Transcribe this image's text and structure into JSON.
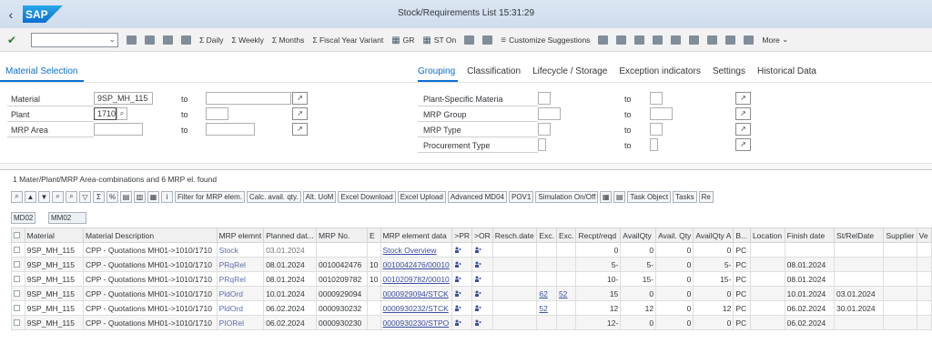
{
  "shell": {
    "title": "Stock/Requirements List 15:31:29",
    "logo": "SAP"
  },
  "toolbar": {
    "buttons": [
      "Σ Daily",
      "Σ Weekly",
      "Σ Months",
      "Σ Fiscal Year Variant",
      "GR",
      "ST On",
      "Customize Suggestions",
      "More"
    ]
  },
  "selection": {
    "section_title": "Material Selection",
    "tabs": [
      "Grouping",
      "Classification",
      "Lifecycle / Storage",
      "Exception indicators",
      "Settings",
      "Historical Data"
    ],
    "fields": {
      "material_label": "Material",
      "material_value": "9SP_MH_115",
      "plant_label": "Plant",
      "plant_value": "1710",
      "mrp_area_label": "MRP Area",
      "to": "to",
      "plant_specific_label": "Plant-Specific Materia",
      "mrp_group_label": "MRP Group",
      "mrp_type_label": "MRP Type",
      "procurement_label": "Procurement Type"
    }
  },
  "results": {
    "summary": "1 Mater/Plant/MRP Area-combinations and 6 MRP el. found",
    "alv_buttons": [
      "Filter for MRP elem.",
      "Calc. avail. qty.",
      "Alt. UoM",
      "Excel Download",
      "Excel Upload",
      "Advanced MD04",
      "POV1",
      "Simulation On/Off",
      "Task Object",
      "Tasks",
      "Re"
    ],
    "variants": [
      "MD02",
      "MM02"
    ],
    "columns": [
      "",
      "Material",
      "Material Description",
      "MRP elemnt",
      "Planned dat...",
      "MRP No.",
      "E",
      "MRP element data",
      ">PR",
      ">OR",
      "Resch.date",
      "Exc.",
      "Exc.",
      "Recpt/reqd",
      "AvailQty",
      "Avail. Qty",
      "AvailQty A",
      "B...",
      "Location",
      "Finish date",
      "St/RelDate",
      "Supplier",
      "Ve"
    ],
    "rows": [
      {
        "material": "9SP_MH_115",
        "desc": "CPP - Quotations MH01->1010/1710",
        "elem": "Stock",
        "planned": "03.01.2024",
        "mrpno": "",
        "e": "",
        "data": "Stock Overview",
        "exc1": "",
        "exc2": "",
        "recpt": "0",
        "avail": "0",
        "availq": "0",
        "availa": "0",
        "b": "PC",
        "loc": "",
        "finish": "",
        "strel": ""
      },
      {
        "material": "9SP_MH_115",
        "desc": "CPP - Quotations MH01->1010/1710",
        "elem": "PRqRel",
        "planned": "08.01.2024",
        "mrpno": "0010042476",
        "e": "10",
        "data": "0010042476/00010",
        "exc1": "",
        "exc2": "",
        "recpt": "5-",
        "avail": "5-",
        "availq": "0",
        "availa": "5-",
        "b": "PC",
        "loc": "",
        "finish": "08.01.2024",
        "strel": ""
      },
      {
        "material": "9SP_MH_115",
        "desc": "CPP - Quotations MH01->1010/1710",
        "elem": "PRqRel",
        "planned": "08.01.2024",
        "mrpno": "0010209782",
        "e": "10",
        "data": "0010209782/00010",
        "exc1": "",
        "exc2": "",
        "recpt": "10-",
        "avail": "15-",
        "availq": "0",
        "availa": "15-",
        "b": "PC",
        "loc": "",
        "finish": "08.01.2024",
        "strel": ""
      },
      {
        "material": "9SP_MH_115",
        "desc": "CPP - Quotations MH01->1010/1710",
        "elem": "PldOrd",
        "planned": "10.01.2024",
        "mrpno": "0000929094",
        "e": "",
        "data": "0000929094/STCK",
        "exc1": "62",
        "exc2": "52",
        "recpt": "15",
        "avail": "0",
        "availq": "0",
        "availa": "0",
        "b": "PC",
        "loc": "",
        "finish": "10.01.2024",
        "strel": "03.01.2024"
      },
      {
        "material": "9SP_MH_115",
        "desc": "CPP - Quotations MH01->1010/1710",
        "elem": "PldOrd",
        "planned": "06.02.2024",
        "mrpno": "0000930232",
        "e": "",
        "data": "0000930232/STCK",
        "exc1": "52",
        "exc2": "",
        "recpt": "12",
        "avail": "12",
        "availq": "0",
        "availa": "12",
        "b": "PC",
        "loc": "",
        "finish": "06.02.2024",
        "strel": "30.01.2024"
      },
      {
        "material": "9SP_MH_115",
        "desc": "CPP - Quotations MH01->1010/1710",
        "elem": "PIORel",
        "planned": "06.02.2024",
        "mrpno": "0000930230",
        "e": "",
        "data": "0000930230/STPO",
        "exc1": "",
        "exc2": "",
        "recpt": "12-",
        "avail": "0",
        "availq": "0",
        "availa": "0",
        "b": "PC",
        "loc": "",
        "finish": "06.02.2024",
        "strel": ""
      }
    ]
  }
}
